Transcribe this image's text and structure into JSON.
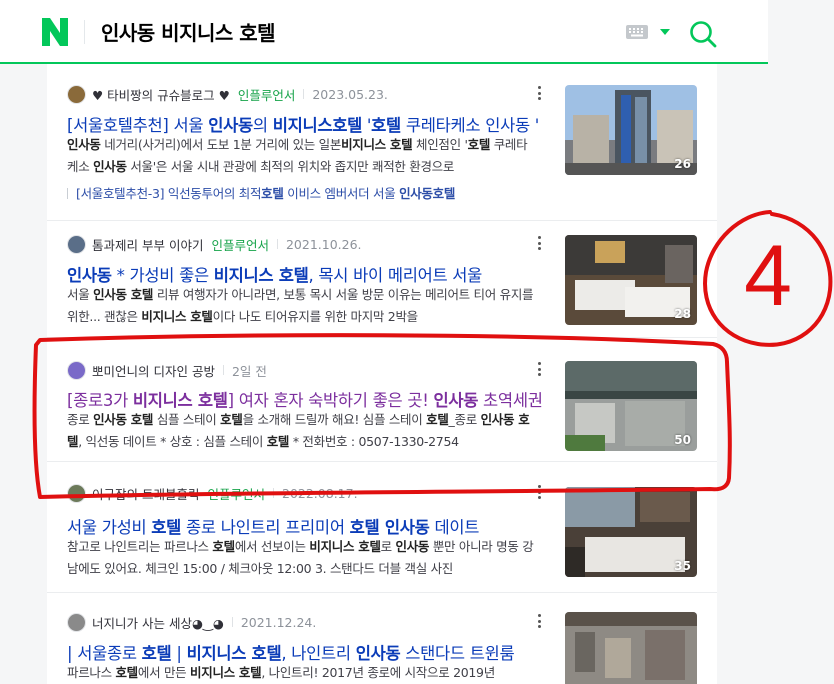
{
  "header": {
    "logo_letter": "N",
    "query": "인사동 비지니스 호텔",
    "accent_color": "#03c75a"
  },
  "items": [
    {
      "author": "♥ 타비짱의 규슈블로그 ♥",
      "badge": "인플루언서",
      "date": "2023.05.23.",
      "title_parts": [
        {
          "t": "[서울호텔추천] 서울 "
        },
        {
          "t": "인사동",
          "b": true
        },
        {
          "t": "의 "
        },
        {
          "t": "비지니스호텔",
          "b": true
        },
        {
          "t": " '"
        },
        {
          "t": "호텔",
          "b": true
        },
        {
          "t": " 쿠레타케소 인사동 '"
        }
      ],
      "desc_parts": [
        {
          "t": "인사동",
          "b": true
        },
        {
          "t": " 네거리(사거리)에서 도보 1분 거리에 있는 일본"
        },
        {
          "t": "비지니스 호텔",
          "b": true
        },
        {
          "t": " 체인점인 '"
        },
        {
          "t": "호텔",
          "b": true
        },
        {
          "t": " 쿠레타케소 "
        },
        {
          "t": "인사동",
          "b": true
        },
        {
          "t": " 서울'은 서울 시내 관광에 최적의 위치와 좁지만 쾌적한 환경으로"
        }
      ],
      "sub_parts": [
        {
          "t": "[서울호텔추천-3] 익선동투어의 최적"
        },
        {
          "t": "호텔",
          "b": true
        },
        {
          "t": " 이비스 엠버서더 서울 "
        },
        {
          "t": "인사동호텔",
          "b": true
        }
      ],
      "thumb_count": "26"
    },
    {
      "author": "톰과제리 부부 이야기",
      "badge": "인플루언서",
      "date": "2021.10.26.",
      "title_parts": [
        {
          "t": "인사동",
          "b": true
        },
        {
          "t": " * 가성비 좋은 "
        },
        {
          "t": "비지니스 호텔",
          "b": true
        },
        {
          "t": ", 목시 바이 메리어트 서울"
        }
      ],
      "desc_parts": [
        {
          "t": "서울 "
        },
        {
          "t": "인사동 호텔",
          "b": true
        },
        {
          "t": " 리뷰 여행자가 아니라면, 보통 목시 서울 방문 이유는 메리어트 티어 유지를 위한... 괜찮은 "
        },
        {
          "t": "비지니스 호텔",
          "b": true
        },
        {
          "t": "이다 나도 티어유지를 위한 마지막 2박을"
        }
      ],
      "thumb_count": "28"
    },
    {
      "author": "뽀미언니의 디자인 공방",
      "badge": "",
      "date": "2일 전",
      "title_parts": [
        {
          "t": "[종로3가 "
        },
        {
          "t": "비지니스 호텔",
          "b": true
        },
        {
          "t": "] 여자 혼자 숙박하기 좋은 곳! "
        },
        {
          "t": "인사동",
          "b": true
        },
        {
          "t": " 초역세권"
        }
      ],
      "desc_parts": [
        {
          "t": "종로 "
        },
        {
          "t": "인사동 호텔",
          "b": true
        },
        {
          "t": " 심플 스테이 "
        },
        {
          "t": "호텔",
          "b": true
        },
        {
          "t": "을 소개해 드릴까 해요! 심플 스테이 "
        },
        {
          "t": "호텔",
          "b": true
        },
        {
          "t": "_종로 "
        },
        {
          "t": "인사동 호텔",
          "b": true
        },
        {
          "t": ", 익선동 데이트 * 상호 : 심플 스테이 "
        },
        {
          "t": "호텔",
          "b": true
        },
        {
          "t": " * 전화번호 : 0507-1330-2754"
        }
      ],
      "thumb_count": "50"
    },
    {
      "author": "이구잡의 트래블홀릭",
      "badge": "인플루언서",
      "date": "2022.08.17.",
      "title_parts": [
        {
          "t": "서울 가성비 "
        },
        {
          "t": "호텔",
          "b": true
        },
        {
          "t": " 종로 나인트리 프리미어 "
        },
        {
          "t": "호텔 인사동",
          "b": true
        },
        {
          "t": " 데이트"
        }
      ],
      "desc_parts": [
        {
          "t": "참고로 나인트리는 파르나스 "
        },
        {
          "t": "호텔",
          "b": true
        },
        {
          "t": "에서 선보이는 "
        },
        {
          "t": "비지니스 호텔",
          "b": true
        },
        {
          "t": "로 "
        },
        {
          "t": "인사동",
          "b": true
        },
        {
          "t": " 뿐만 아니라 명동 강남에도 있어요. 체크인 15:00 / 체크아웃 12:00 3. 스탠다드 더블 객실 사진"
        }
      ],
      "thumb_count": "35"
    },
    {
      "author": "너지니가 사는 세상◕‿◕",
      "badge": "",
      "date": "2021.12.24.",
      "title_parts": [
        {
          "t": "| 서울종로 "
        },
        {
          "t": "호텔",
          "b": true
        },
        {
          "t": " | "
        },
        {
          "t": "비지니스 호텔",
          "b": true
        },
        {
          "t": ", 나인트리 "
        },
        {
          "t": "인사동",
          "b": true
        },
        {
          "t": " 스탠다드 트윈룸"
        }
      ],
      "desc_parts": [
        {
          "t": "파르나스 "
        },
        {
          "t": "호텔",
          "b": true
        },
        {
          "t": "에서 만든 "
        },
        {
          "t": "비지니스 호텔",
          "b": true
        },
        {
          "t": ", 나인트리! 2017년 종로에 시작으로 2019년"
        }
      ],
      "thumb_count": ""
    }
  ],
  "annotation": {
    "label": "4",
    "color": "#e01010"
  }
}
